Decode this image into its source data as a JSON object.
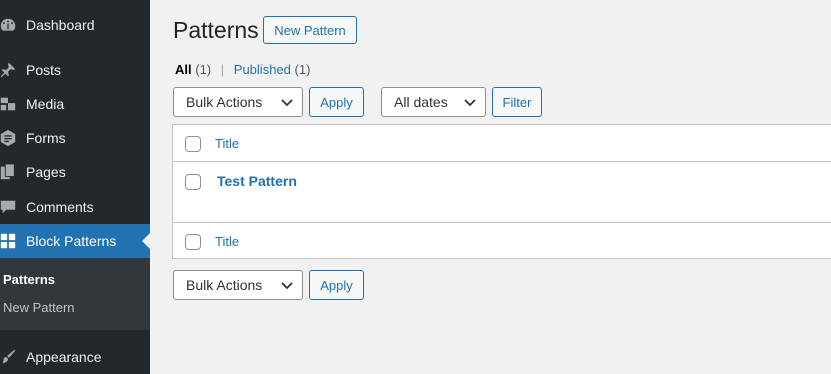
{
  "sidebar": {
    "items": [
      {
        "label": "Dashboard",
        "icon": "dashboard-icon"
      },
      {
        "label": "Posts",
        "icon": "pin-icon"
      },
      {
        "label": "Media",
        "icon": "media-icon"
      },
      {
        "label": "Forms",
        "icon": "forms-icon"
      },
      {
        "label": "Pages",
        "icon": "pages-icon"
      },
      {
        "label": "Comments",
        "icon": "comment-icon"
      },
      {
        "label": "Block Patterns",
        "icon": "grid-icon",
        "active": true
      },
      {
        "label": "Appearance",
        "icon": "brush-icon"
      }
    ],
    "submenu": [
      {
        "label": "Patterns",
        "current": true
      },
      {
        "label": "New Pattern"
      }
    ]
  },
  "header": {
    "title": "Patterns",
    "new_button": "New Pattern"
  },
  "filters": {
    "all_label": "All",
    "all_count": "(1)",
    "separator": "|",
    "published_label": "Published",
    "published_count": "(1)"
  },
  "tablenav_top": {
    "bulk_actions": "Bulk Actions",
    "apply": "Apply",
    "dates": "All dates",
    "filter": "Filter"
  },
  "table": {
    "header_title": "Title",
    "rows": [
      {
        "title": "Test Pattern"
      }
    ],
    "footer_title": "Title"
  },
  "tablenav_bottom": {
    "bulk_actions": "Bulk Actions",
    "apply": "Apply"
  },
  "colors": {
    "sidebar_bg": "#23282d",
    "active_bg": "#2271b1",
    "link": "#2271b1",
    "page_bg": "#f1f1f1"
  }
}
